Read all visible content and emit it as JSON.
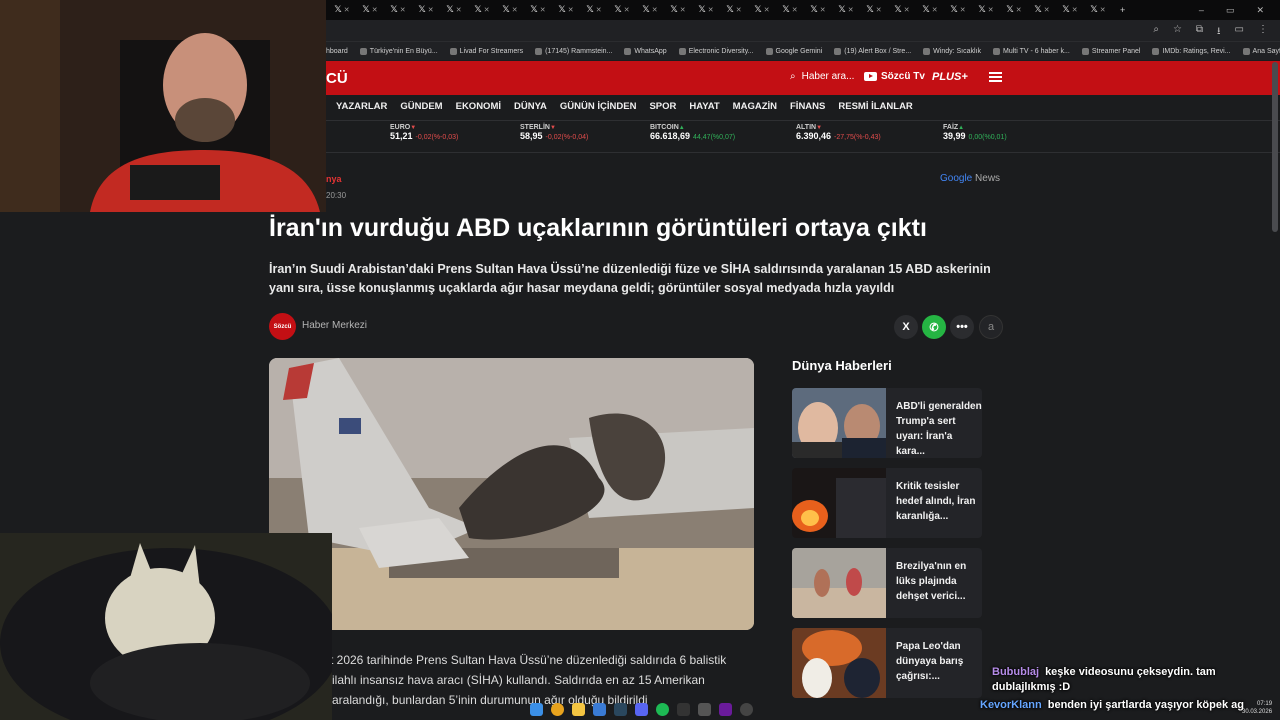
{
  "browser": {
    "tab_glyph": "𝕏",
    "tab_count": 28,
    "window_controls": [
      "–",
      "▭",
      "✕"
    ],
    "new_tab": "+",
    "addr_icons": [
      "⌕",
      "☆",
      "⧉",
      "⭳",
      "▭",
      "⋮"
    ],
    "bookmarks": [
      "hboard",
      "Türkiye'nin En Büyü...",
      "Livad For Streamers",
      "(17145) Rammstein...",
      "WhatsApp",
      "Electronic Diversity...",
      "Google Gemini",
      "(19) Alert Box / Stre...",
      "Windy: Sıcaklık",
      "Multi TV - 6 haber k...",
      "Streamer Panel",
      "IMDb: Ratings, Revi...",
      "Ana Sayfa • HBO Max",
      "»",
      "Tüm Yer İşaretleri"
    ]
  },
  "site": {
    "logo": "CÜ",
    "search_label": "Haber ara...",
    "tv_label": "Sözcü Tv",
    "plus_label": "PLUS+",
    "nav": [
      "YAZARLAR",
      "GÜNDEM",
      "EKONOMİ",
      "DÜNYA",
      "GÜNÜN İÇİNDEN",
      "SPOR",
      "HAYAT",
      "MAGAZİN",
      "FİNANS",
      "RESMİ İLANLAR"
    ],
    "markets": [
      {
        "name": "9)",
        "value": "",
        "change": "",
        "dir": ""
      },
      {
        "name": "EURO",
        "value": "51,21",
        "change": "-0,02(%-0,03)",
        "dir": "down"
      },
      {
        "name": "STERLİN",
        "value": "58,95",
        "change": "-0,02(%-0,04)",
        "dir": "down"
      },
      {
        "name": "BITCOIN",
        "value": "66.618,69",
        "change": "44,47(%0,07)",
        "dir": "up"
      },
      {
        "name": "ALTIN",
        "value": "6.390,46",
        "change": "-27,75(%-0,43)",
        "dir": "down"
      },
      {
        "name": "FAİZ",
        "value": "39,99",
        "change": "0,00(%0,01)",
        "dir": "up"
      }
    ]
  },
  "article": {
    "category": "nya",
    "time": "20:30",
    "google_news": "Google",
    "google_news_suffix": "News",
    "title": "İran'ın vurduğu ABD uçaklarının görüntüleri ortaya çıktı",
    "summary": "İran’ın Suudi Arabistan’daki Prens Sultan Hava Üssü’ne düzenlediği füze ve SİHA saldırısında yaralanan 15 ABD askerinin yanı sıra, üsse konuşlanmış uçaklarda ağır hasar meydana geldi; görüntüler sosyal medyada hızla yayıldı",
    "author_logo": "Sözcü",
    "author": "Haber Merkezi",
    "share_x": "X",
    "share_wa": "✆",
    "share_more": "•••",
    "share_a": "a",
    "body_lines": [
      "rt 2026 tarihinde Prens Sultan Hava Üssü’ne düzenlediği saldırıda 6 balistik",
      "silahlı insansız hava aracı (SİHA) kullandı. Saldırıda en az 15 Amerikan",
      "yaralandığı, bunlardan 5’inin durumunun ağır olduğu bildirildi"
    ]
  },
  "sidebar": {
    "title": "Dünya Haberleri",
    "items": [
      {
        "text": "ABD'li generalden Trump'a sert uyarı: İran'a kara..."
      },
      {
        "text": "Kritik tesisler hedef alındı, İran karanlığa..."
      },
      {
        "text": "Brezilya'nın en lüks plajında dehşet verici..."
      },
      {
        "text": "Papa Leo'dan dünyaya barış çağrısı:..."
      }
    ]
  },
  "chat": [
    {
      "user": "Bubublaj",
      "message": "keşke videosunu çekseydin. tam dublajlıkmış :D"
    },
    {
      "user": "KevorKlann",
      "message": "benden iyi şartlarda yaşıyor köpek ag"
    }
  ],
  "clock": {
    "time": "07:19",
    "date": "30.03.2026"
  },
  "colors": {
    "brand_red": "#c30f14",
    "whatsapp_green": "#25b543",
    "down": "#e24c4c",
    "up": "#31b15a"
  }
}
